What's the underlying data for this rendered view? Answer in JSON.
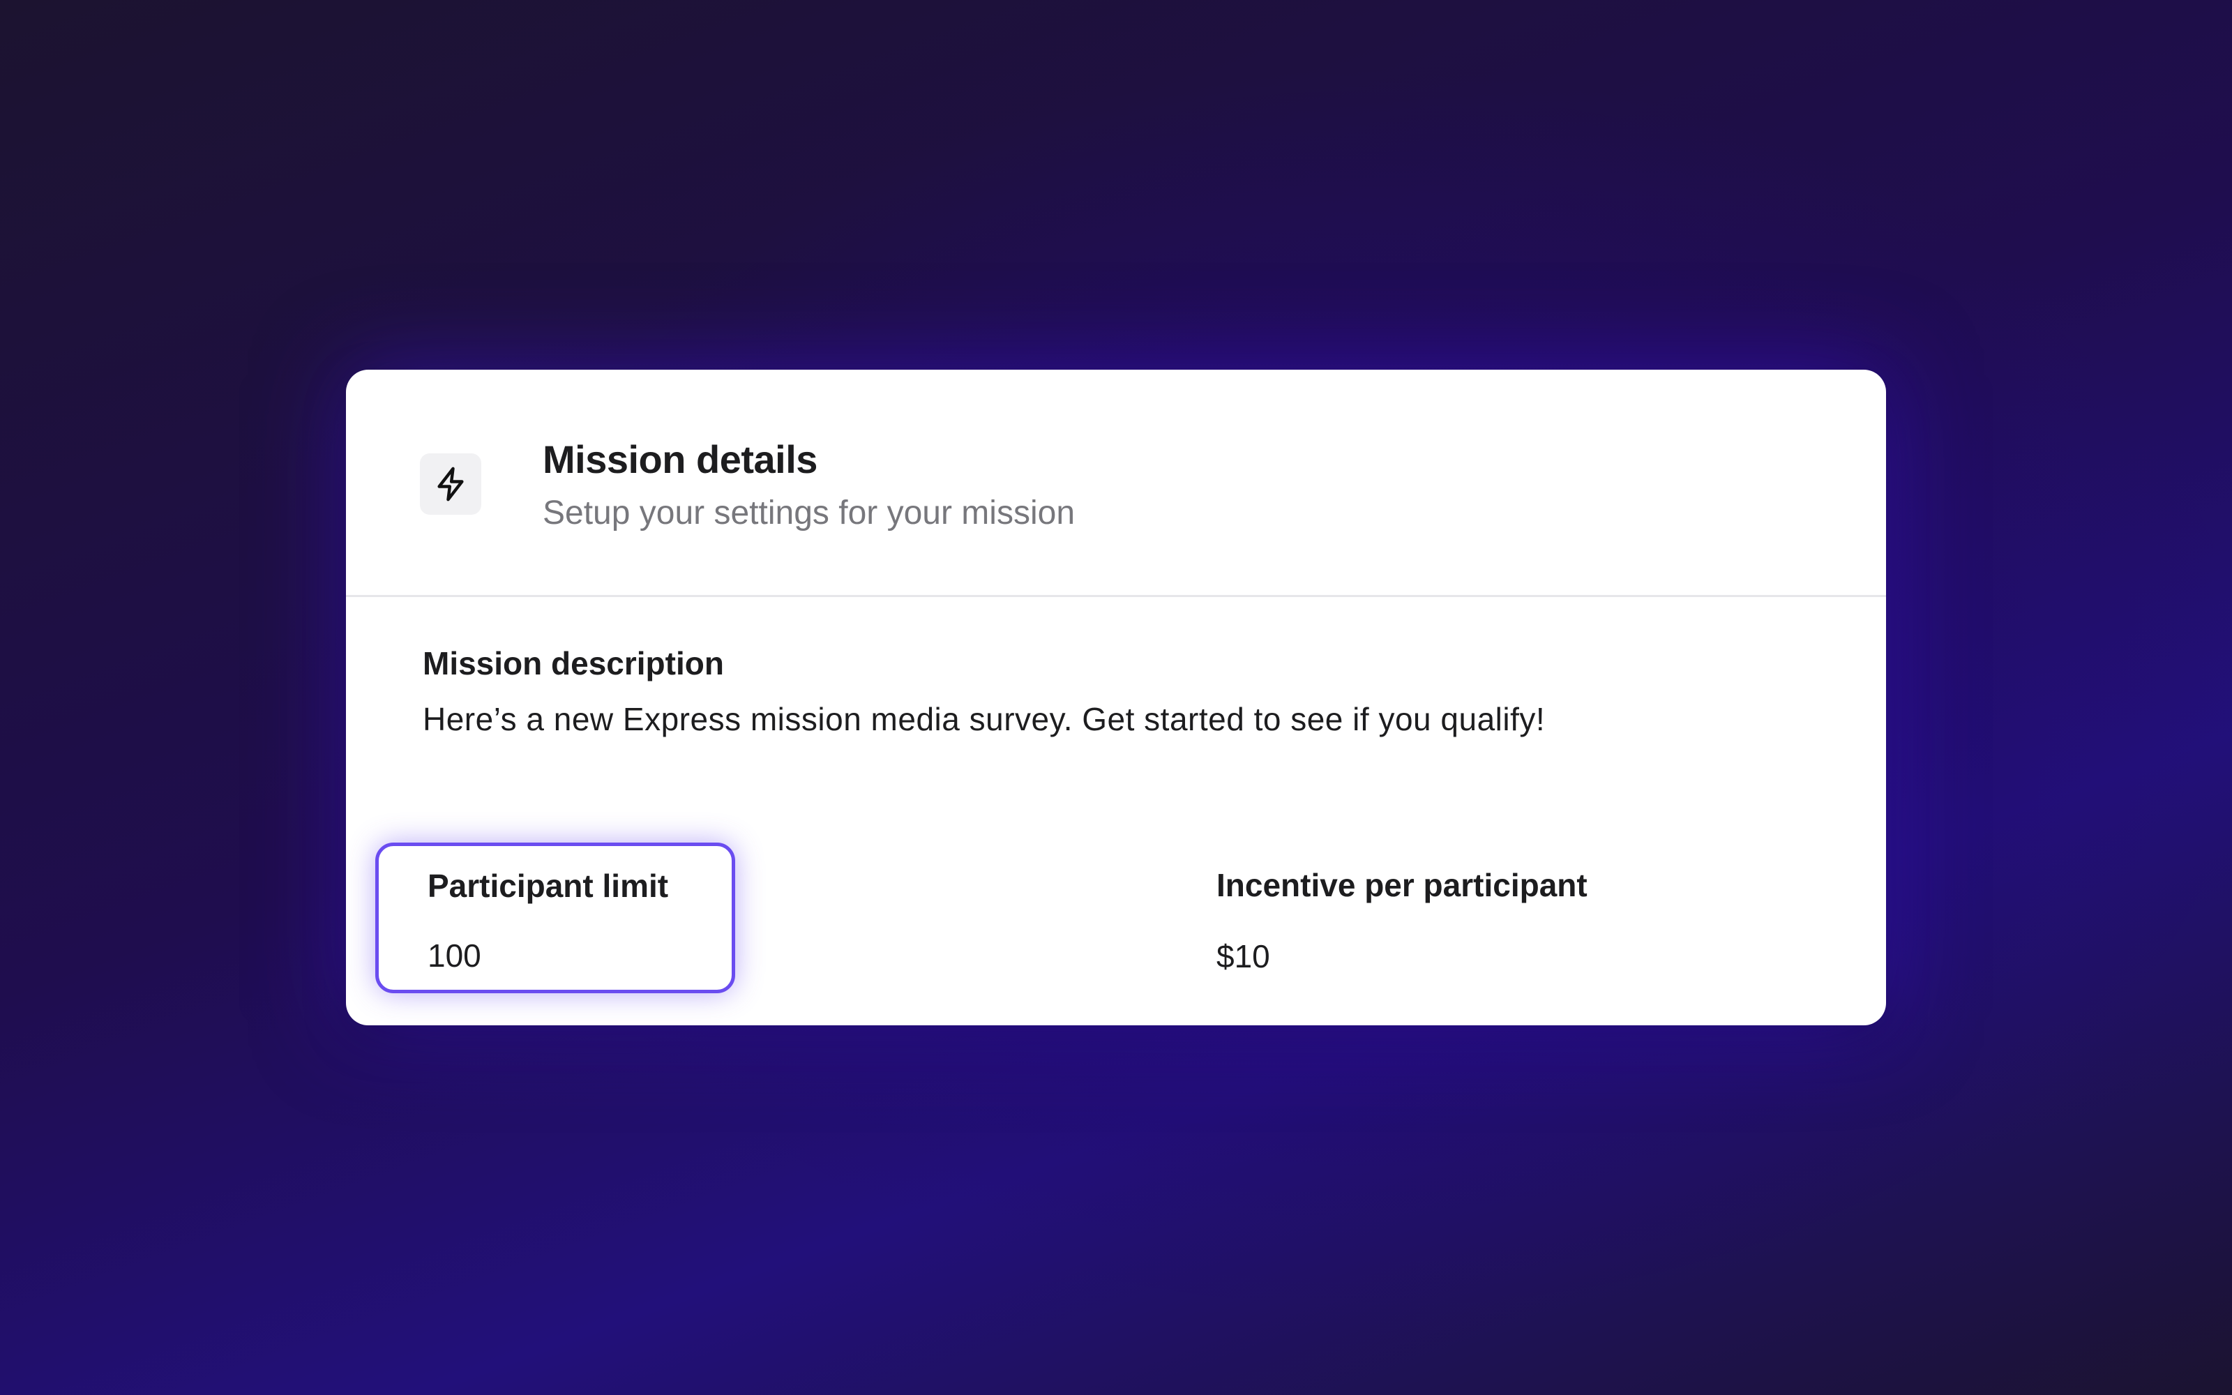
{
  "header": {
    "icon": "lightning-bolt-icon",
    "title": "Mission details",
    "subtitle": "Setup your settings for your mission"
  },
  "description": {
    "label": "Mission description",
    "text": "Here’s a new Express mission media survey. Get started to see if you qualify!"
  },
  "fields": {
    "participant_limit": {
      "label": "Participant limit",
      "value": "100"
    },
    "incentive": {
      "label": "Incentive per participant",
      "value": "$10"
    }
  },
  "colors": {
    "accent": "#6a4cf0",
    "background": "#1f0d4e",
    "card": "#ffffff",
    "text_primary": "#1d1d1f",
    "text_secondary": "#77777c"
  }
}
